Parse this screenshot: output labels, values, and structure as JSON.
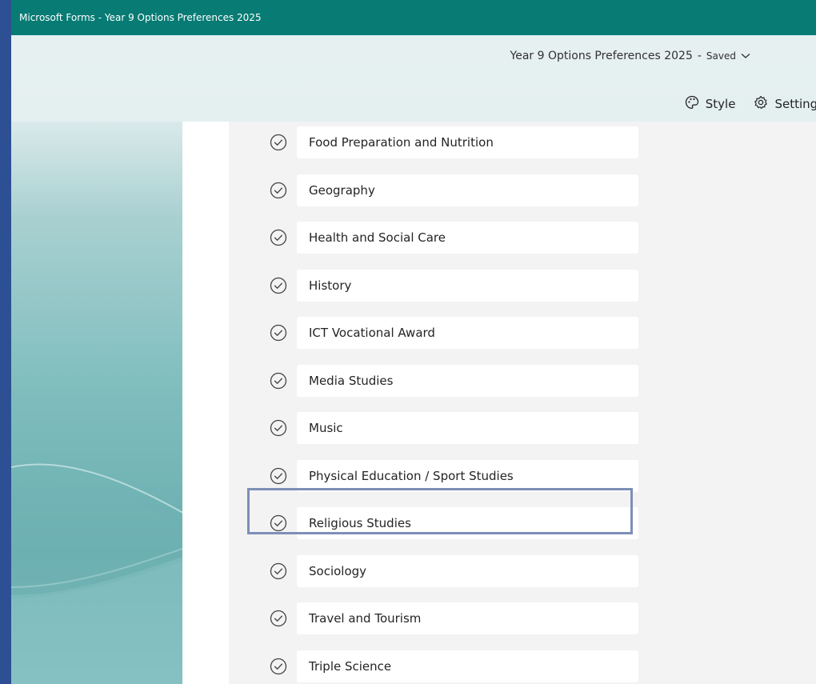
{
  "window": {
    "title": "Microsoft Forms - Year 9 Options Preferences 2025"
  },
  "header": {
    "form_title": "Year 9 Options Preferences 2025",
    "separator": "-",
    "save_status": "Saved"
  },
  "toolbar": {
    "style_label": "Style",
    "settings_label": "Settings"
  },
  "options": [
    {
      "label": "Food Preparation and Nutrition"
    },
    {
      "label": "Geography"
    },
    {
      "label": "Health and Social Care"
    },
    {
      "label": "History"
    },
    {
      "label": "ICT Vocational Award"
    },
    {
      "label": "Media Studies"
    },
    {
      "label": "Music"
    },
    {
      "label": "Physical Education / Sport Studies"
    },
    {
      "label": "Religious Studies"
    },
    {
      "label": "Sociology"
    },
    {
      "label": "Travel and Tourism"
    },
    {
      "label": "Triple Science"
    }
  ],
  "focused_option_index": 7,
  "colors": {
    "titlebar": "#077b74",
    "focus_outline": "#7d8fb7",
    "banner_teal": "#6aaeb0"
  }
}
